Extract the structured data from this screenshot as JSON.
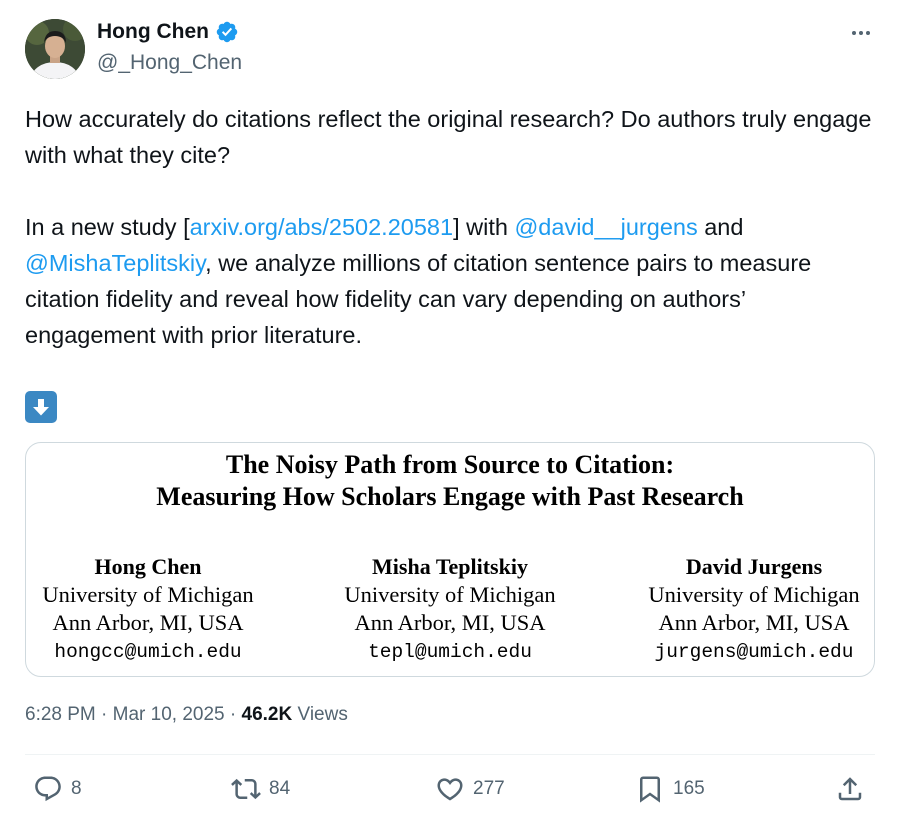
{
  "author": {
    "display_name": "Hong Chen",
    "handle": "@_Hong_Chen",
    "verified": true
  },
  "tweet": {
    "line1": "How accurately do citations reflect the original research? Do authors truly engage with what they cite?",
    "p2_pre": "In a new study [",
    "p2_link": "arxiv.org/abs/2502.20581",
    "p2_mid": "] with ",
    "mention1": "@david__jurgens",
    "p2_and": " and ",
    "mention2": "@MishaTeplitskiy",
    "p2_post": ", we analyze millions of citation sentence pairs to measure citation fidelity and reveal how fidelity can vary depending on authors’ engagement with prior literature.",
    "emoji_icon": "down-arrow-emoji-icon"
  },
  "paper_card": {
    "title_line1": "The Noisy Path from Source to Citation:",
    "title_line2": "Measuring How Scholars Engage with Past Research",
    "authors": [
      {
        "name": "Hong Chen",
        "affiliation": "University of Michigan",
        "location": "Ann Arbor, MI, USA",
        "email": "hongcc@umich.edu"
      },
      {
        "name": "Misha Teplitskiy",
        "affiliation": "University of Michigan",
        "location": "Ann Arbor, MI, USA",
        "email": "tepl@umich.edu"
      },
      {
        "name": "David Jurgens",
        "affiliation": "University of Michigan",
        "location": "Ann Arbor, MI, USA",
        "email": "jurgens@umich.edu"
      }
    ]
  },
  "meta": {
    "time": "6:28 PM",
    "sep1": " · ",
    "date": "Mar 10, 2025",
    "sep2": " · ",
    "views_count": "46.2K",
    "views_label": " Views"
  },
  "actions": {
    "replies": "8",
    "reposts": "84",
    "likes": "277",
    "bookmarks": "165"
  },
  "colors": {
    "link": "#1d9bf0",
    "muted": "#536471",
    "verified": "#1d9bf0",
    "emoji_bg": "#3b88c3"
  }
}
